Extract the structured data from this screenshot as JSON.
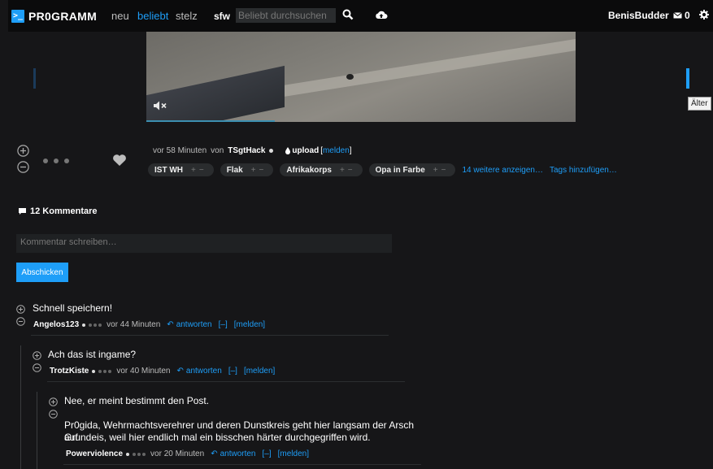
{
  "header": {
    "logo_text": "PR0GRAMM",
    "logo_symbol": ">_",
    "nav": {
      "neu": "neu",
      "beliebt": "beliebt",
      "stelz": "stelz",
      "sfw": "sfw"
    },
    "search_placeholder": "Beliebt durchsuchen",
    "username": "BenisBudder",
    "inbox_count": "0",
    "accent_color": "#1e9ef8"
  },
  "media": {
    "tooltip": "Älter",
    "muted": true
  },
  "post": {
    "time": "vor 58 Minuten",
    "by": "von",
    "author": "TSgtHack",
    "upload_label": "upload",
    "report_label": "melden",
    "tags": [
      {
        "label": "IST WH"
      },
      {
        "label": "Flak"
      },
      {
        "label": "Afrikakorps"
      },
      {
        "label": "Opa in Farbe"
      }
    ],
    "tags_more": "14 weitere anzeigen…",
    "tags_add": "Tags hinzufügen…"
  },
  "comments": {
    "count_label": "12 Kommentare",
    "input_placeholder": "Kommentar schreiben…",
    "submit_label": "Abschicken",
    "items": [
      {
        "text": "Schnell speichern!",
        "author": "Angelos123",
        "time": "vor 44 Minuten",
        "reply": "antworten",
        "collapse": "[–]",
        "report": "[melden]"
      },
      {
        "text": "Ach das ist ingame?",
        "author": "TrotzKiste",
        "time": "vor 40 Minuten",
        "reply": "antworten",
        "collapse": "[–]",
        "report": "[melden]"
      },
      {
        "text": "Nee, er meint bestimmt den Post.",
        "text2_line1": "Pr0gida, Wehrmachtsverehrer und deren Dunstkreis geht hier langsam der Arsch auf",
        "text2_line2": "Grundeis, weil hier endlich mal ein bisschen härter durchgegriffen wird.",
        "author": "Powerviolence",
        "time": "vor 20 Minuten",
        "reply": "antworten",
        "collapse": "[–]",
        "report": "[melden]"
      }
    ]
  }
}
